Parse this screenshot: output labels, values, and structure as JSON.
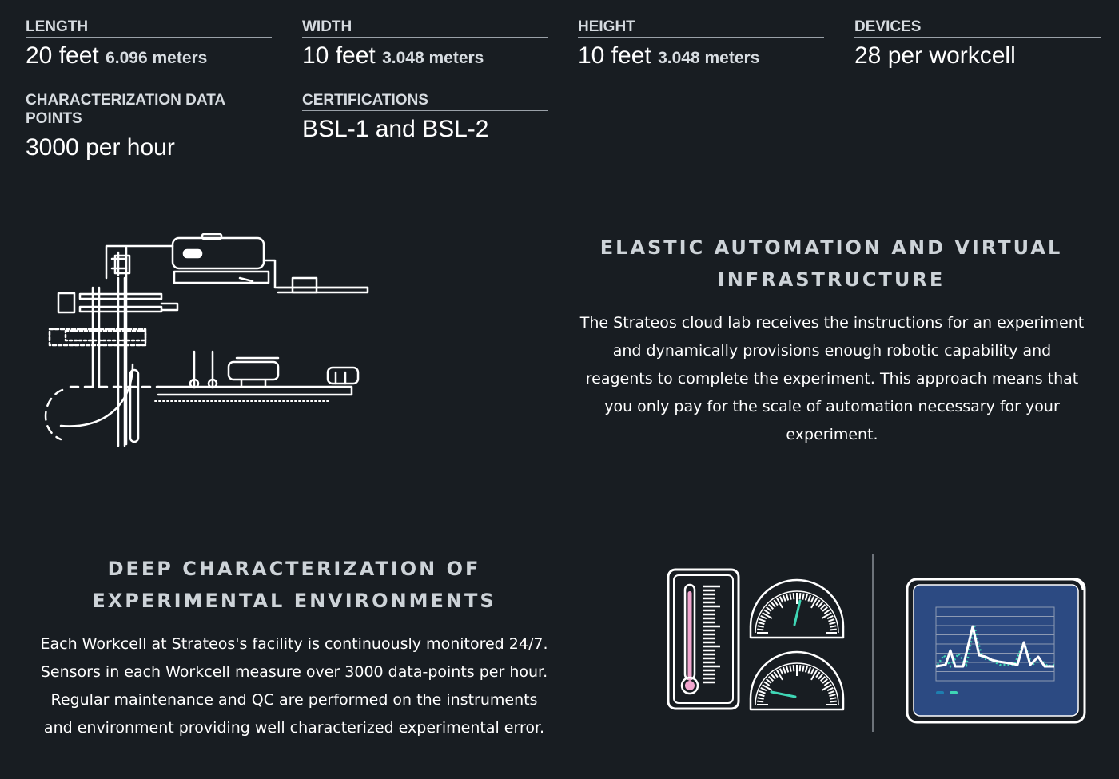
{
  "specs": {
    "length": {
      "label": "LENGTH",
      "value": "20 feet",
      "sub": "6.096 meters"
    },
    "width": {
      "label": "WIDTH",
      "value": "10 feet",
      "sub": "3.048 meters"
    },
    "height": {
      "label": "HEIGHT",
      "value": "10 feet",
      "sub": "3.048 meters"
    },
    "devices": {
      "label": "DEVICES",
      "value": "28 per workcell"
    },
    "characterization": {
      "label": "CHARACTERIZATION DATA POINTS",
      "value": "3000 per hour"
    },
    "certifications": {
      "label": "CERTIFICATIONS",
      "value": "BSL-1 and BSL-2"
    }
  },
  "elastic": {
    "heading": "ELASTIC AUTOMATION AND VIRTUAL INFRASTRUCTURE",
    "body": "The Strateos cloud lab receives the instructions for an experiment and dynamically provisions enough robotic capability and reagents to complete the experiment. This approach means that you only pay for the scale of automation necessary for your experiment."
  },
  "deep": {
    "heading": "DEEP CHARACTERIZATION OF EXPERIMENTAL ENVIRONMENTS",
    "body": "Each Workcell at Strateos's facility is continuously monitored 24/7. Sensors in each Workcell measure over 3000 data-points per hour. Regular maintenance and QC are performed on the instruments and environment providing well characterized experimental error."
  },
  "icons": {
    "robot": "robotic-arm-illustration",
    "thermometer": "thermometer-icon",
    "gauge_top": "gauge-icon",
    "gauge_bottom": "gauge-icon",
    "monitor": "monitor-chart-icon"
  },
  "colors": {
    "background": "#181d22",
    "accent_teal": "#3fd6b5",
    "accent_pink": "#f2a6cf",
    "monitor_blue": "#2c4a82"
  }
}
